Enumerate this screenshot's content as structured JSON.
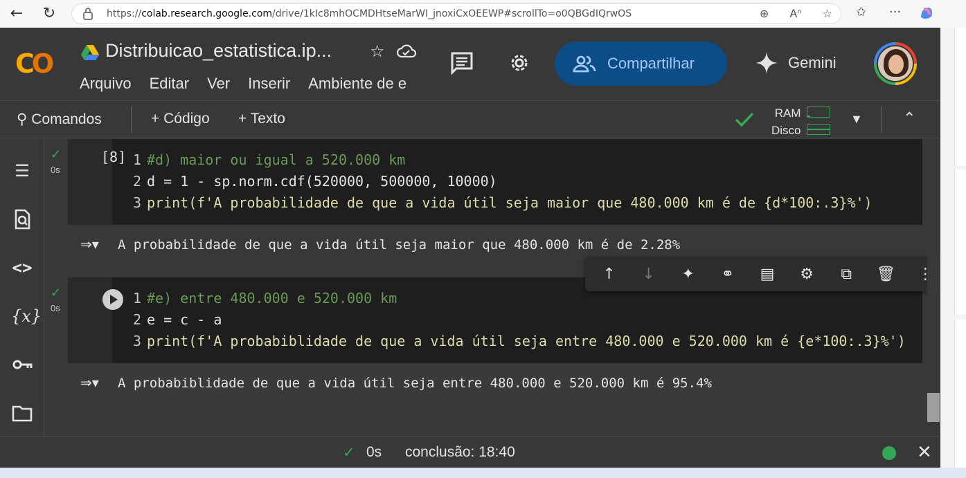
{
  "browser": {
    "url_prefix": "https://",
    "url_domain": "colab.research.google.com",
    "url_rest": "/drive/1kIc8mhOCMDHtseMarWI_jnoxiCxOEEWP#scrollTo=o0QBGdIQrwOS"
  },
  "header": {
    "title": "Distribuicao_estatistica.ip...",
    "menu": [
      "Arquivo",
      "Editar",
      "Ver",
      "Inserir",
      "Ambiente de e"
    ],
    "share_label": "Compartilhar",
    "gemini_label": "Gemini"
  },
  "toolbar": {
    "commands": "Comandos",
    "add_code": "+ Código",
    "add_text": "+ Texto",
    "ram": "RAM",
    "disk": "Disco"
  },
  "cells": [
    {
      "exec_count": "[8]",
      "time": "0s",
      "lines": [
        "#d) maior ou igual a 520.000 km",
        "d = 1 - sp.norm.cdf(520000, 500000, 10000)",
        "print(f'A probabilidade de que a vida útil seja maior que 480.000 km é de {d*100:.3}%')"
      ],
      "output": "A probabilidade de que a vida útil seja maior que 480.000 km é de 2.28%"
    },
    {
      "time": "0s",
      "lines": [
        "#e) entre 480.000 e 520.000 km",
        "e = c - a",
        "print(f'A probabiblidade de que a vida útil seja entre 480.000 e 520.000 km é {e*100:.3}%')"
      ],
      "output": "A probabiblidade de que a vida útil seja entre 480.000 e 520.000 km é 95.4%"
    }
  ],
  "status": {
    "check": "✓",
    "duration": "0s",
    "completion": "conclusão: 18:40"
  }
}
